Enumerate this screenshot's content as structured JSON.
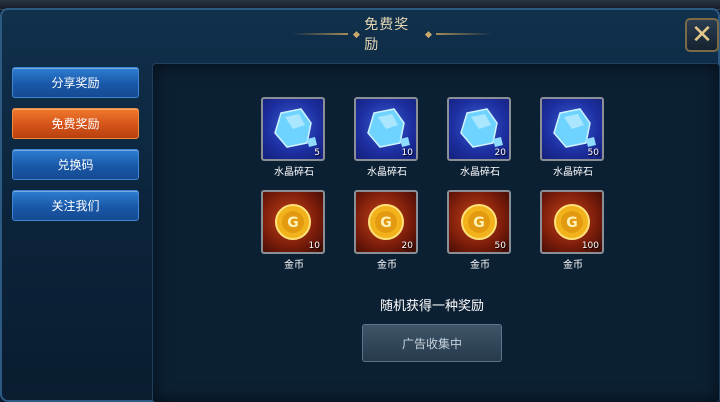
{
  "dialog": {
    "title": "免费奖励",
    "close_label": "✕"
  },
  "tabs": [
    {
      "label": "分享奖励"
    },
    {
      "label": "免费奖励"
    },
    {
      "label": "兑换码"
    },
    {
      "label": "关注我们"
    }
  ],
  "active_tab": "免费奖励",
  "rewards": [
    {
      "name": "水晶碎石",
      "qty": "5",
      "icon": "crystal-icon"
    },
    {
      "name": "水晶碎石",
      "qty": "10",
      "icon": "crystal-icon"
    },
    {
      "name": "水晶碎石",
      "qty": "20",
      "icon": "crystal-icon"
    },
    {
      "name": "水晶碎石",
      "qty": "50",
      "icon": "crystal-icon"
    },
    {
      "name": "金币",
      "qty": "10",
      "icon": "gold-coin-icon"
    },
    {
      "name": "金币",
      "qty": "20",
      "icon": "gold-coin-icon"
    },
    {
      "name": "金币",
      "qty": "50",
      "icon": "gold-coin-icon"
    },
    {
      "name": "金币",
      "qty": "100",
      "icon": "gold-coin-icon"
    }
  ],
  "hint": "随机获得一种奖励",
  "collect_button": "广告收集中",
  "colors": {
    "tab_blue": "#1e63b4",
    "tab_active_orange": "#e0621e",
    "panel_bg": "#0c2034",
    "title_gold": "#e6d7b2"
  }
}
